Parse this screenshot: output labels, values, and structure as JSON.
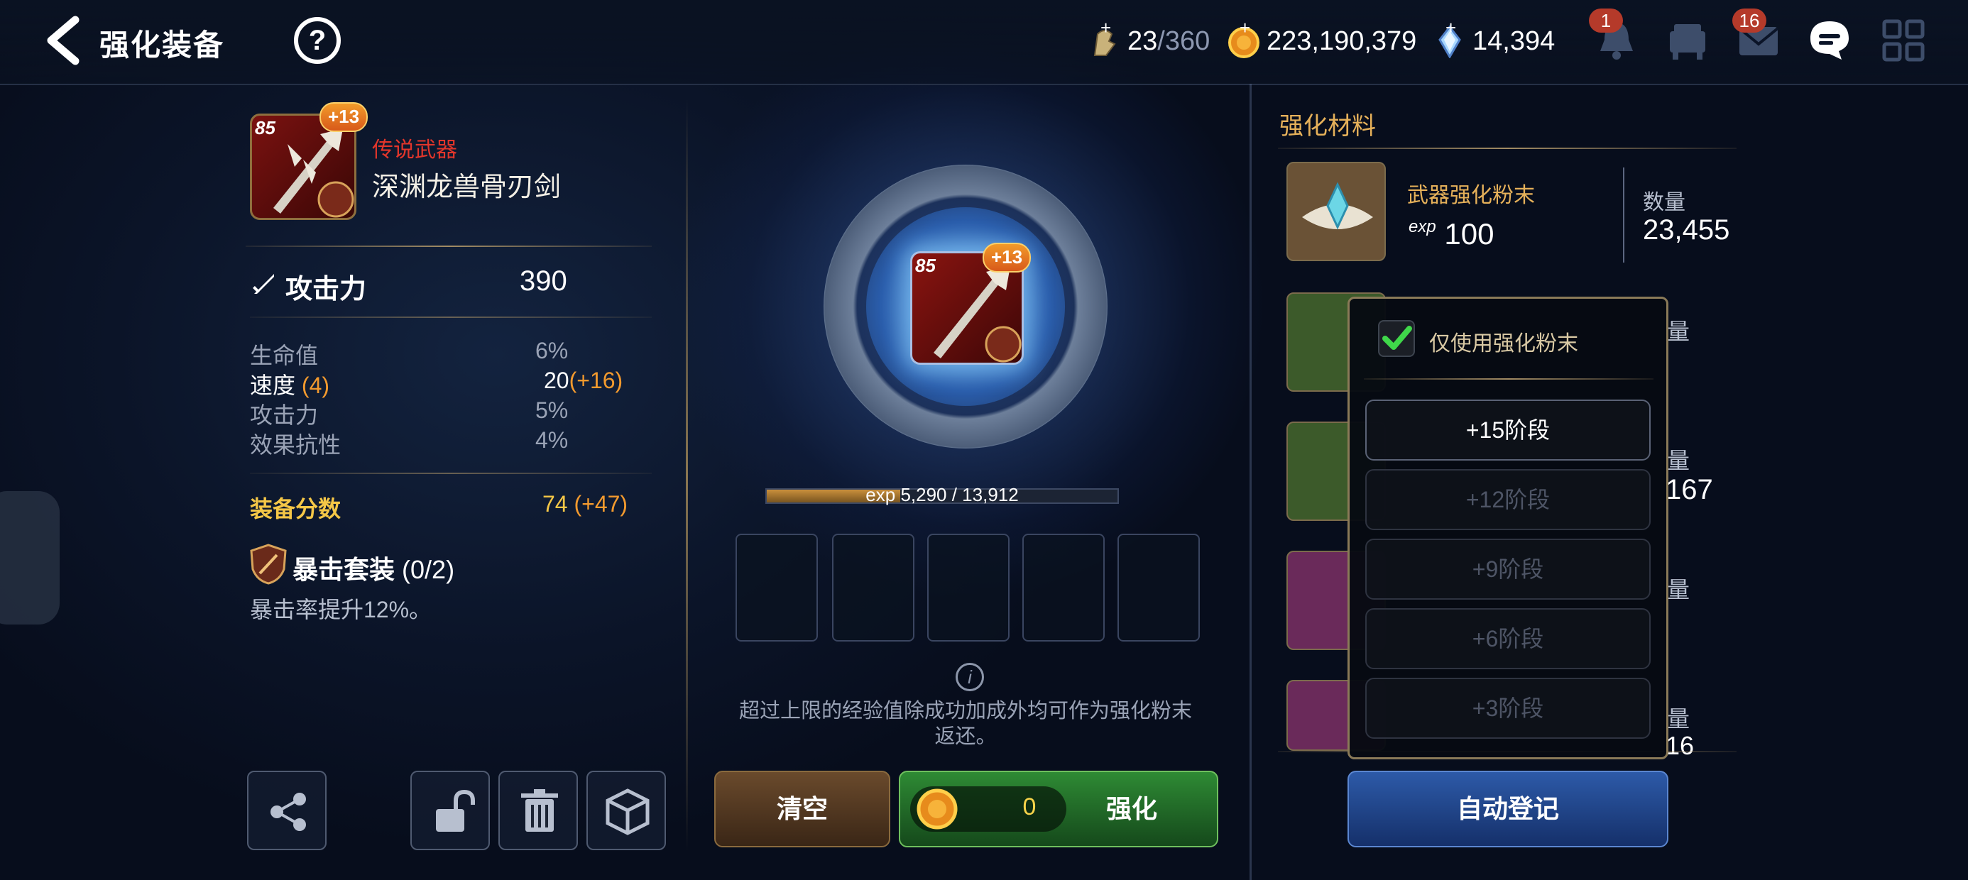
{
  "header": {
    "title": "强化装备",
    "stamina": {
      "current": "23",
      "max": "/360"
    },
    "gold": "223,190,379",
    "crystals": "14,394",
    "notification_badge": "1",
    "mail_badge": "16"
  },
  "item": {
    "level": "85",
    "plus": "+13",
    "rarity": "传说武器",
    "name": "深渊龙兽骨刃剑",
    "main_stat": {
      "label": "攻击力",
      "value": "390"
    },
    "sub_stats": [
      {
        "label": "生命值",
        "value": "6%",
        "extra": ""
      },
      {
        "label": "速度",
        "label_extra": "(4)",
        "value": "20",
        "extra": "(+16)"
      },
      {
        "label": "攻击力",
        "value": "5%",
        "extra": ""
      },
      {
        "label": "效果抗性",
        "value": "4%",
        "extra": ""
      }
    ],
    "gear_score": {
      "label": "装备分数",
      "value": "74",
      "extra": "(+47)"
    },
    "set": {
      "name": "暴击套装",
      "count": "(0/2)",
      "desc": "暴击率提升12%。"
    }
  },
  "center": {
    "exp_text": "exp 5,290 / 13,912",
    "exp_progress": 0.38,
    "notice": "超过上限的经验值除成功加成外均可作为强化粉末返还。",
    "clear_label": "清空",
    "cost": "0",
    "enhance_label": "强化"
  },
  "materials": {
    "title": "强化材料",
    "first": {
      "name": "武器强化粉末",
      "exp_prefix": "exp",
      "exp": "100",
      "qty_label": "数量",
      "qty": "23,455"
    },
    "edge_labels": [
      "量",
      "量",
      "167",
      "量",
      "量",
      "16"
    ]
  },
  "popup": {
    "checkbox_label": "仅使用强化粉末",
    "checked": true,
    "stages": [
      {
        "label": "+15阶段",
        "active": true
      },
      {
        "label": "+12阶段",
        "active": false
      },
      {
        "label": "+9阶段",
        "active": false
      },
      {
        "label": "+6阶段",
        "active": false
      },
      {
        "label": "+3阶段",
        "active": false
      }
    ]
  },
  "auto_label": "自动登记",
  "colors": {
    "rarity": "#e2362b",
    "score": "#f5c747",
    "bonus": "#f39a2e",
    "enhance": "#2e8a34",
    "auto": "#2d5aa8"
  }
}
